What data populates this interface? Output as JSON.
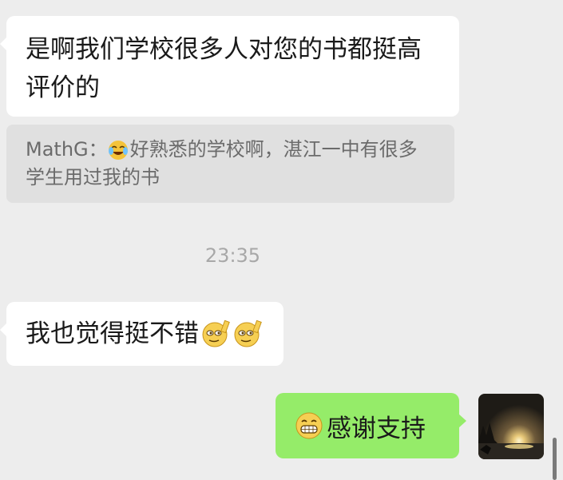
{
  "messages": [
    {
      "side": "left",
      "text": "是啊我们学校很多人对您的书都挺高评价的"
    },
    {
      "side": "left",
      "text": "我也觉得挺不错"
    },
    {
      "side": "right",
      "text": "感谢支持"
    }
  ],
  "quote": {
    "sender": "MathG：",
    "text": "好熟悉的学校啊，湛江一中有很多学生用过我的书"
  },
  "timestamp": "23:35",
  "icons": {
    "quote_emoji": "laugh-cry-emoji-icon",
    "msg2_emojis": [
      "clever-emoji-icon",
      "clever-emoji-icon"
    ],
    "reply_emoji": "grin-emoji-icon",
    "avatar": "sunset-lake-avatar"
  },
  "colors": {
    "background": "#ededed",
    "incoming_bubble": "#ffffff",
    "outgoing_bubble": "#95ec69",
    "quote_bg": "#e0e0e0"
  }
}
